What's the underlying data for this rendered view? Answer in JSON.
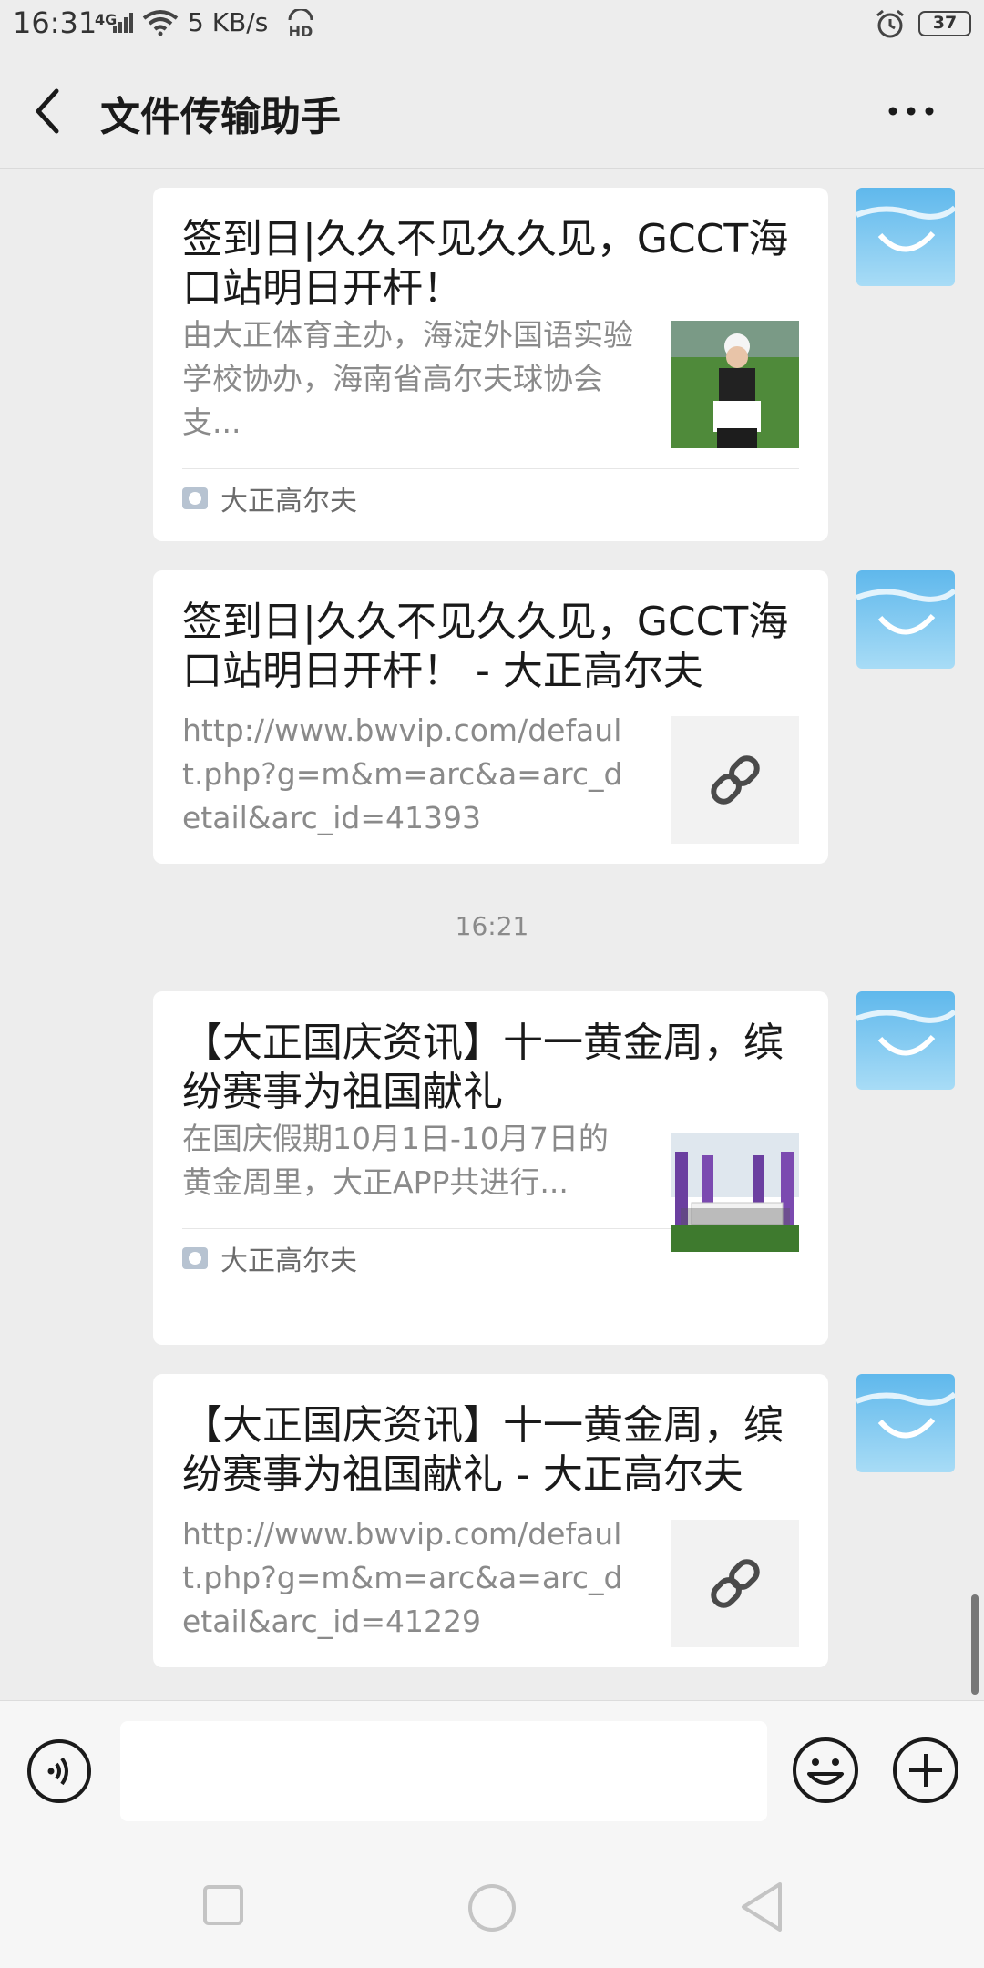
{
  "status_bar": {
    "time": "16:31",
    "network": "4G",
    "speed": "5 KB/s",
    "battery": "37",
    "battery_level": 0.37
  },
  "header": {
    "title": "文件传输助手"
  },
  "messages": [
    {
      "type": "article",
      "title": "签到日|久久不见久久见，GCCT海口站明日开杆！",
      "description": "由大正体育主办，海淀外国语实验学校协办，海南省高尔夫球协会支...",
      "source": "大正高尔夫"
    },
    {
      "type": "link",
      "title": "签到日|久久不见久久见，GCCT海口站明日开杆！ - 大正高尔夫",
      "description": "http://www.bwvip.com/default.php?g=m&m=arc&a=arc_detail&arc_id=41393"
    },
    {
      "type": "article",
      "title": "【大正国庆资讯】十一黄金周，缤纷赛事为祖国献礼",
      "description": "在国庆假期10月1日-10月7日的黄金周里，大正APP共进行...",
      "source": "大正高尔夫"
    },
    {
      "type": "link",
      "title": "【大正国庆资讯】十一黄金周，缤纷赛事为祖国献礼 - 大正高尔夫",
      "description": "http://www.bwvip.com/default.php?g=m&m=arc&a=arc_detail&arc_id=41229"
    }
  ],
  "time_separator": "16:21",
  "input_bar": {
    "placeholder": ""
  },
  "icons": {
    "back": "back-arrow-icon",
    "more": "more-dots-icon",
    "voice": "voice-icon",
    "emoji": "emoji-icon",
    "plus": "plus-icon",
    "link": "link-icon"
  },
  "colors": {
    "background": "#ededed",
    "card": "#ffffff",
    "muted_text": "#8a8a8a"
  }
}
